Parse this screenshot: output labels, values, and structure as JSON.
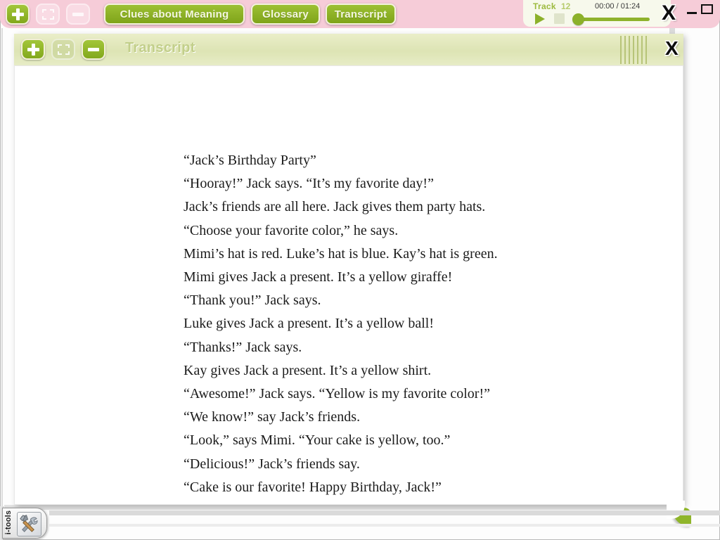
{
  "window": {
    "close_label": "X",
    "minimize_label": "minimize",
    "maximize_label": "maximize"
  },
  "toolbar": {
    "zoom_in_label": "+",
    "fullscreen_label": "fullscreen",
    "zoom_out_label": "-",
    "nav_buttons": [
      {
        "label": "Clues about Meaning",
        "active": true
      },
      {
        "label": "Glossary",
        "active": true
      },
      {
        "label": "Transcript",
        "active": true
      }
    ]
  },
  "player": {
    "track_label": "Track",
    "track_number": "12",
    "time_display": "00:00 / 01:24",
    "play_icon": "play-icon",
    "stop_icon": "stop-icon",
    "seek_position_percent": 0
  },
  "inner_window": {
    "title": "Transcript",
    "zoom_in_label": "+",
    "fullscreen_label": "fullscreen",
    "zoom_out_label": "-",
    "close_label": "X"
  },
  "transcript": {
    "lines": [
      "“Jack’s Birthday Party”",
      "“Hooray!” Jack says. “It’s my favorite day!”",
      "Jack’s friends are all here. Jack gives them party hats.",
      "“Choose your favorite color,” he says.",
      "Mimi’s hat is red. Luke’s hat is blue. Kay’s hat is green.",
      "Mimi gives Jack a present. It’s a yellow giraffe!",
      "“Thank you!” Jack says.",
      "Luke gives Jack a present. It’s a yellow ball!",
      "“Thanks!” Jack says.",
      "Kay gives Jack a present. It’s a yellow shirt.",
      "“Awesome!” Jack says. “Yellow is my favorite color!”",
      "“We know!” say Jack’s friends.",
      "“Look,” says Mimi. “Your cake is yellow, too.”",
      "“Delicious!” Jack’s friends say.",
      "“Cake is our favorite! Happy Birthday, Jack!”"
    ]
  },
  "footer": {
    "itools_label": "i-tools",
    "itools_icon": "hammer-wrench-icon",
    "page_curl_icon": "page-curl-icon"
  },
  "colors": {
    "toolbar_pink": "#f6ccd8",
    "button_green": "#8fb524",
    "header_olive": "#dde4b4",
    "title_text": "#c2cf8a",
    "accent_green": "#8cb12a"
  }
}
